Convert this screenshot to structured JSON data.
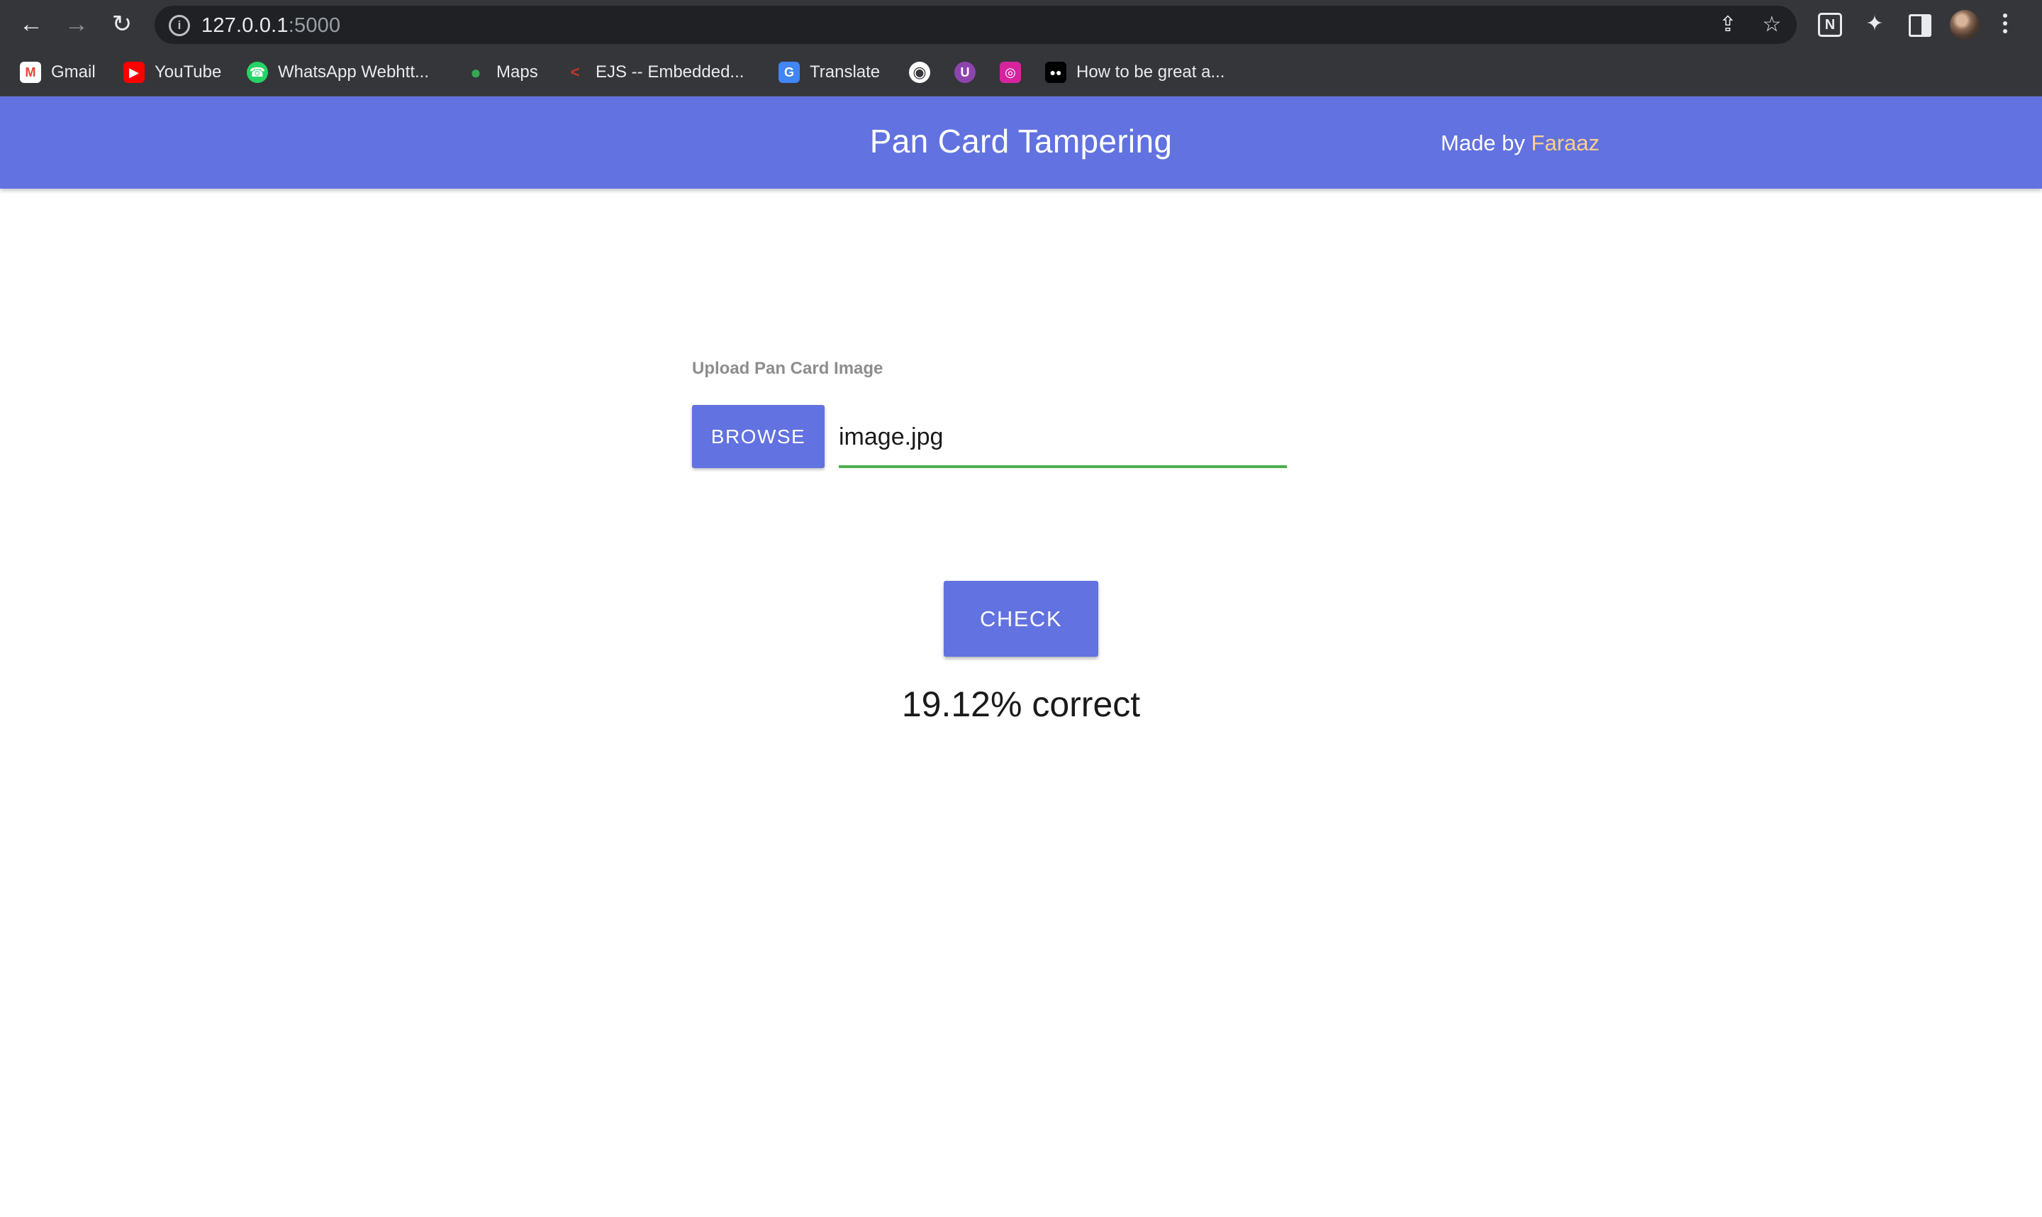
{
  "browser": {
    "url_host": "127.0.0.1",
    "url_port": ":5000",
    "bookmarks": [
      {
        "label": "Gmail",
        "icon": "gmail-icon"
      },
      {
        "label": "YouTube",
        "icon": "youtube-icon"
      },
      {
        "label": "WhatsApp Webhtt...",
        "icon": "whatsapp-icon"
      },
      {
        "label": "Maps",
        "icon": "maps-icon"
      },
      {
        "label": "EJS -- Embedded...",
        "icon": "ejs-icon"
      },
      {
        "label": "Translate",
        "icon": "translate-icon"
      },
      {
        "label": "",
        "icon": "globe-icon"
      },
      {
        "label": "",
        "icon": "u-app-icon"
      },
      {
        "label": "",
        "icon": "instagram-icon"
      },
      {
        "label": "How to be great a...",
        "icon": "medium-icon"
      }
    ]
  },
  "header": {
    "title": "Pan Card Tampering",
    "made_by_prefix": "Made by",
    "author": "Faraaz"
  },
  "form": {
    "upload_label": "Upload Pan Card Image",
    "browse_label": "BROWSE",
    "file_name": "image.jpg",
    "check_label": "CHECK"
  },
  "result": {
    "text": "19.12% correct"
  },
  "colors": {
    "accent": "#6272e0",
    "author": "#ffcf8c",
    "field_underline": "#4caf50"
  }
}
